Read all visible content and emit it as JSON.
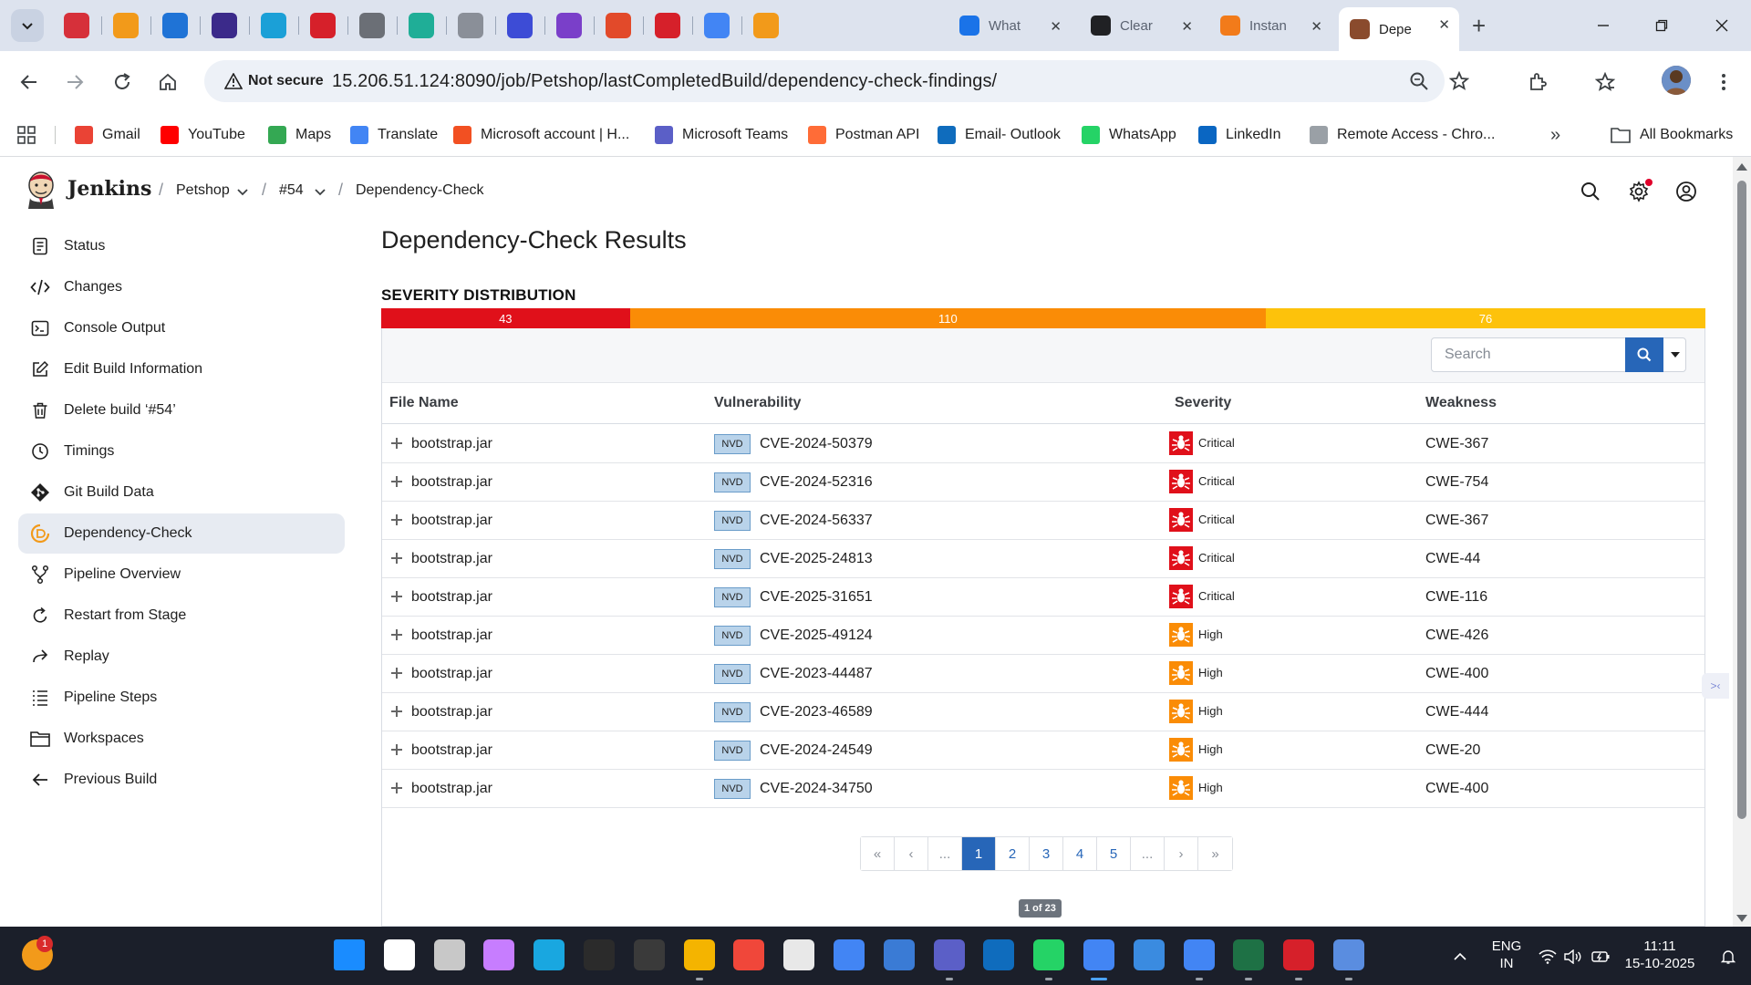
{
  "browser": {
    "tabs": [
      {
        "title": "What",
        "color": "#1a73e8"
      },
      {
        "title": "Clear",
        "color": "#202124"
      },
      {
        "title": "Instan",
        "color": "#f27b1a"
      },
      {
        "title": "Depe",
        "color": "#8a4b2d"
      }
    ],
    "pinned_colors": [
      "#d6303a",
      "#f29a1a",
      "#1f73d6",
      "#3b2a8a",
      "#1ba0d7",
      "#d6202a",
      "#6b6f76",
      "#1fae97",
      "#8a8f98",
      "#3d4cd6",
      "#7a3fc9",
      "#e24a2a",
      "#d6202a",
      "#4285f4",
      "#f29a1a"
    ],
    "security_label": "Not secure",
    "url": "15.206.51.124:8090/job/Petshop/lastCompletedBuild/dependency-check-findings/",
    "bookmarks": [
      {
        "label": "Gmail",
        "color": "#ea4335"
      },
      {
        "label": "YouTube",
        "color": "#ff0000"
      },
      {
        "label": "Maps",
        "color": "#34a853"
      },
      {
        "label": "Translate",
        "color": "#4285f4"
      },
      {
        "label": "Microsoft account | H...",
        "color": "#f25022"
      },
      {
        "label": "Microsoft Teams",
        "color": "#5b5fc7"
      },
      {
        "label": "Postman API",
        "color": "#ff6c37"
      },
      {
        "label": "Email- Outlook",
        "color": "#0f6cbd"
      },
      {
        "label": "WhatsApp",
        "color": "#25d366"
      },
      {
        "label": "LinkedIn",
        "color": "#0a66c2"
      },
      {
        "label": "Remote Access - Chro...",
        "color": "#9aa0a6"
      }
    ],
    "all_bookmarks": "All Bookmarks"
  },
  "jenkins": {
    "brand": "Jenkins",
    "breadcrumb": [
      "Petshop",
      "#54",
      "Dependency-Check"
    ]
  },
  "sidebar": {
    "items": [
      {
        "label": "Status",
        "icon": "document-icon"
      },
      {
        "label": "Changes",
        "icon": "code-icon"
      },
      {
        "label": "Console Output",
        "icon": "terminal-icon"
      },
      {
        "label": "Edit Build Information",
        "icon": "edit-icon"
      },
      {
        "label": "Delete build ‘#54’",
        "icon": "trash-icon"
      },
      {
        "label": "Timings",
        "icon": "clock-icon"
      },
      {
        "label": "Git Build Data",
        "icon": "git-icon"
      },
      {
        "label": "Dependency-Check",
        "icon": "dependency-check-icon",
        "active": true
      },
      {
        "label": "Pipeline Overview",
        "icon": "pipeline-icon"
      },
      {
        "label": "Restart from Stage",
        "icon": "restart-icon"
      },
      {
        "label": "Replay",
        "icon": "replay-icon"
      },
      {
        "label": "Pipeline Steps",
        "icon": "list-icon"
      },
      {
        "label": "Workspaces",
        "icon": "folder-icon"
      },
      {
        "label": "Previous Build",
        "icon": "arrow-left-icon"
      }
    ]
  },
  "main": {
    "title": "Dependency-Check Results",
    "severity_title": "SEVERITY DISTRIBUTION",
    "severity": [
      {
        "label": "43",
        "value": 43,
        "color": "#e0101a"
      },
      {
        "label": "110",
        "value": 110,
        "color": "#fa8c06"
      },
      {
        "label": "76",
        "value": 76,
        "color": "#fdc20b"
      }
    ],
    "search_placeholder": "Search",
    "columns": [
      "File Name",
      "Vulnerability",
      "Severity",
      "Weakness"
    ],
    "rows": [
      {
        "file": "bootstrap.jar",
        "source": "NVD",
        "cve": "CVE-2024-50379",
        "severity": "Critical",
        "cwe": "CWE-367"
      },
      {
        "file": "bootstrap.jar",
        "source": "NVD",
        "cve": "CVE-2024-52316",
        "severity": "Critical",
        "cwe": "CWE-754"
      },
      {
        "file": "bootstrap.jar",
        "source": "NVD",
        "cve": "CVE-2024-56337",
        "severity": "Critical",
        "cwe": "CWE-367"
      },
      {
        "file": "bootstrap.jar",
        "source": "NVD",
        "cve": "CVE-2025-24813",
        "severity": "Critical",
        "cwe": "CWE-44"
      },
      {
        "file": "bootstrap.jar",
        "source": "NVD",
        "cve": "CVE-2025-31651",
        "severity": "Critical",
        "cwe": "CWE-116"
      },
      {
        "file": "bootstrap.jar",
        "source": "NVD",
        "cve": "CVE-2025-49124",
        "severity": "High",
        "cwe": "CWE-426"
      },
      {
        "file": "bootstrap.jar",
        "source": "NVD",
        "cve": "CVE-2023-44487",
        "severity": "High",
        "cwe": "CWE-400"
      },
      {
        "file": "bootstrap.jar",
        "source": "NVD",
        "cve": "CVE-2023-46589",
        "severity": "High",
        "cwe": "CWE-444"
      },
      {
        "file": "bootstrap.jar",
        "source": "NVD",
        "cve": "CVE-2024-24549",
        "severity": "High",
        "cwe": "CWE-20"
      },
      {
        "file": "bootstrap.jar",
        "source": "NVD",
        "cve": "CVE-2024-34750",
        "severity": "High",
        "cwe": "CWE-400"
      }
    ],
    "severity_colors": {
      "Critical": "#e0101a",
      "High": "#fa8c06"
    },
    "pagination": [
      "«",
      "‹",
      "...",
      "1",
      "2",
      "3",
      "4",
      "5",
      "...",
      "›",
      "»"
    ],
    "current_page": "1",
    "page_info": "1 of 23"
  },
  "taskbar": {
    "badge": "1",
    "lang": "ENG",
    "region": "IN",
    "time": "11:11",
    "date": "15-10-2025",
    "app_colors": [
      "#1a8cff",
      "#ffffff",
      "#c8c8c8",
      "#c77dff",
      "#19a7e0",
      "#2b2b2b",
      "#3a3a3a",
      "#f4b400",
      "#f0473a",
      "#e8e8e8",
      "#4285f4",
      "#3a7bd5",
      "#5b5fc7",
      "#0f6cbd",
      "#25d366",
      "#4285f4",
      "#3a8be0",
      "#4285f4",
      "#1e7145",
      "#d6202a",
      "#5a8de0"
    ]
  }
}
